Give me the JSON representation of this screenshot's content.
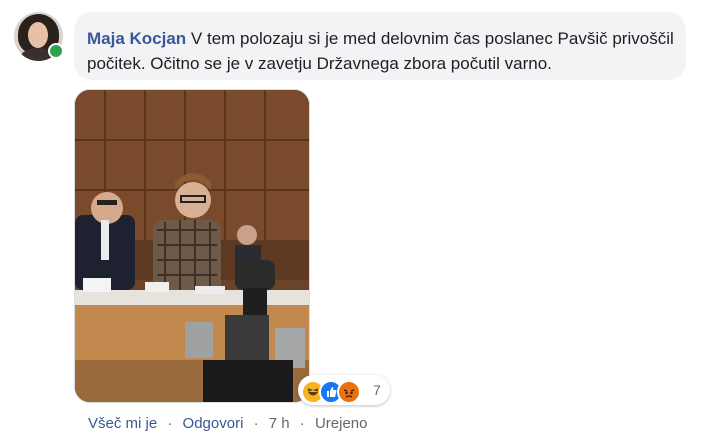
{
  "comment": {
    "author": "Maja Kocjan",
    "text": " V tem polozaju si je med delovnim čas poslanec Pavšič privoščil počitek. Očitno se je v zavetju Državnega zbora počutil varno."
  },
  "reactions": {
    "icons": [
      "haha-icon",
      "like-icon",
      "angry-icon"
    ],
    "count": "7"
  },
  "actions": {
    "like": "Všeč mi je",
    "sep1": "·",
    "reply": "Odgovori",
    "sep2": "·",
    "time": "7 h",
    "sep3": "·",
    "edited": "Urejeno"
  },
  "colors": {
    "author": "#385898",
    "bubble": "#f2f3f5",
    "online": "#31a24c",
    "meta": "#65676b"
  }
}
